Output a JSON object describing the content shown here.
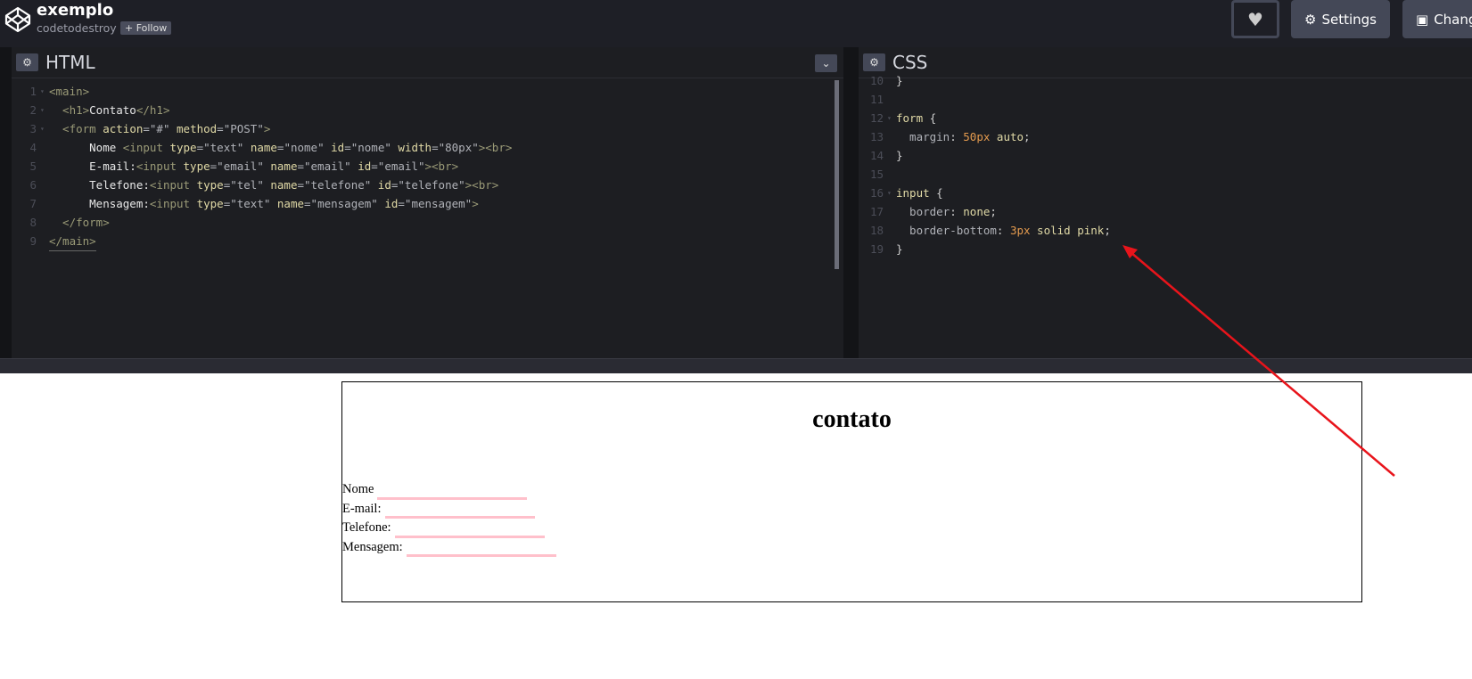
{
  "header": {
    "title": "exemplo",
    "author": "codetodestroy",
    "follow_label": "+ Follow",
    "settings_label": "Settings",
    "change_view_label": "Chang"
  },
  "html_panel": {
    "title": "HTML"
  },
  "css_panel": {
    "title": "CSS"
  },
  "preview": {
    "heading": "contato",
    "fields": [
      "Nome",
      "E-mail:",
      "Telefone:",
      "Mensagem:"
    ]
  },
  "colors": {
    "accent_arrow": "#e8141b",
    "input_border": "pink"
  }
}
